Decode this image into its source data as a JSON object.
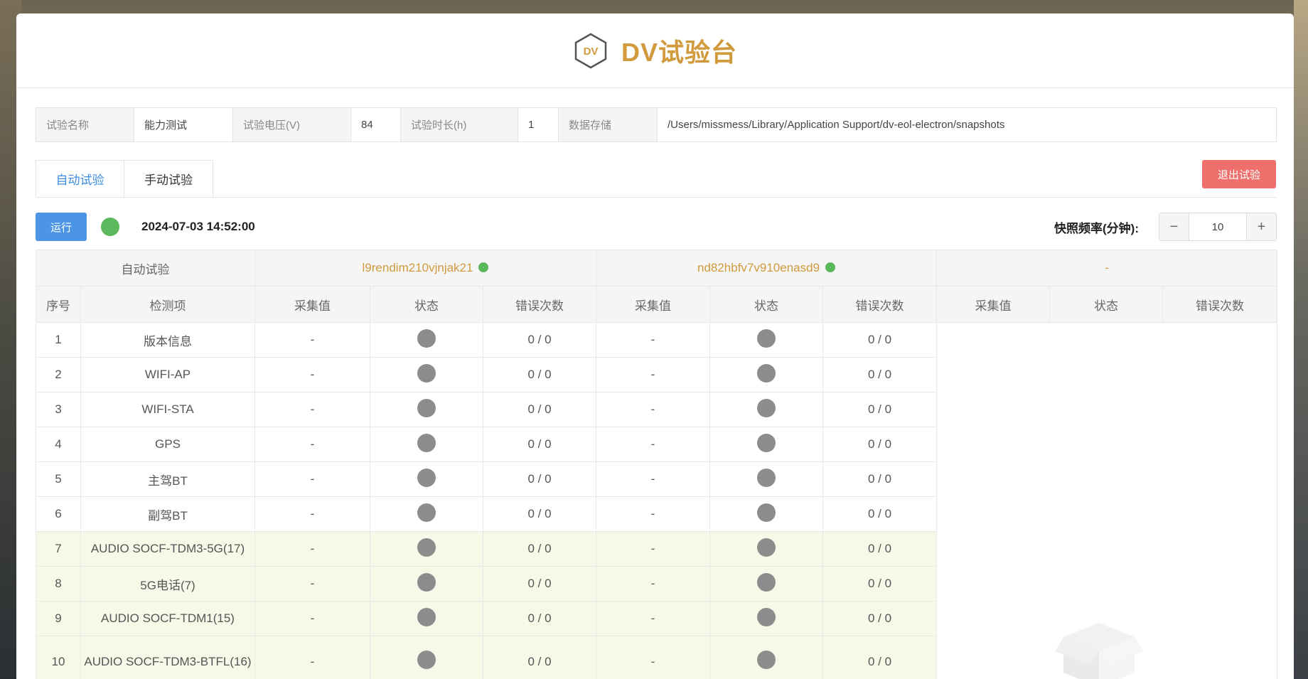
{
  "app": {
    "title": "DV试验台",
    "logo_text": "DV"
  },
  "info": {
    "name_label": "试验名称",
    "name_value": "能力测试",
    "voltage_label": "试验电压(V)",
    "voltage_value": "84",
    "duration_label": "试验时长(h)",
    "duration_value": "1",
    "storage_label": "数据存储",
    "storage_value": "/Users/missmess/Library/Application Support/dv-eol-electron/snapshots"
  },
  "tabs": [
    {
      "label": "自动试验"
    },
    {
      "label": "手动试验"
    }
  ],
  "exit_label": "退出试验",
  "toolbar": {
    "run_label": "运行",
    "datetime": "2024-07-03 14:52:00",
    "freq_label": "快照频率(分钟):",
    "freq_value": "10",
    "minus": "−",
    "plus": "+"
  },
  "table": {
    "group_label": "自动试验",
    "devices": [
      {
        "name": "l9rendim210vjnjak21"
      },
      {
        "name": "nd82hbfv7v910enasd9"
      },
      {
        "name": "-"
      }
    ],
    "col_seq": "序号",
    "col_item": "检测项",
    "col_value": "采集值",
    "col_status": "状态",
    "col_errors": "错误次数",
    "rows": [
      {
        "seq": "1",
        "item": "版本信息",
        "v1": "-",
        "e1": "0 / 0",
        "v2": "-",
        "e2": "0 / 0"
      },
      {
        "seq": "2",
        "item": "WIFI-AP",
        "v1": "-",
        "e1": "0 / 0",
        "v2": "-",
        "e2": "0 / 0"
      },
      {
        "seq": "3",
        "item": "WIFI-STA",
        "v1": "-",
        "e1": "0 / 0",
        "v2": "-",
        "e2": "0 / 0"
      },
      {
        "seq": "4",
        "item": "GPS",
        "v1": "-",
        "e1": "0 / 0",
        "v2": "-",
        "e2": "0 / 0"
      },
      {
        "seq": "5",
        "item": "主驾BT",
        "v1": "-",
        "e1": "0 / 0",
        "v2": "-",
        "e2": "0 / 0"
      },
      {
        "seq": "6",
        "item": "副驾BT",
        "v1": "-",
        "e1": "0 / 0",
        "v2": "-",
        "e2": "0 / 0"
      },
      {
        "seq": "7",
        "item": "AUDIO SOCF-TDM3-5G(17)",
        "v1": "-",
        "e1": "0 / 0",
        "v2": "-",
        "e2": "0 / 0"
      },
      {
        "seq": "8",
        "item": "5G电话(7)",
        "v1": "-",
        "e1": "0 / 0",
        "v2": "-",
        "e2": "0 / 0"
      },
      {
        "seq": "9",
        "item": "AUDIO SOCF-TDM1(15)",
        "v1": "-",
        "e1": "0 / 0",
        "v2": "-",
        "e2": "0 / 0"
      },
      {
        "seq": "10",
        "item": "AUDIO SOCF-TDM3-BTFL(16)",
        "v1": "-",
        "e1": "0 / 0",
        "v2": "-",
        "e2": "0 / 0"
      }
    ]
  },
  "colors": {
    "accent": "#d19a3d",
    "primary": "#4c95e6",
    "danger": "#ef6f6c",
    "ok": "#5cb85c",
    "idle": "#8c8c8c",
    "highlight_row": "#f7f8e8"
  }
}
